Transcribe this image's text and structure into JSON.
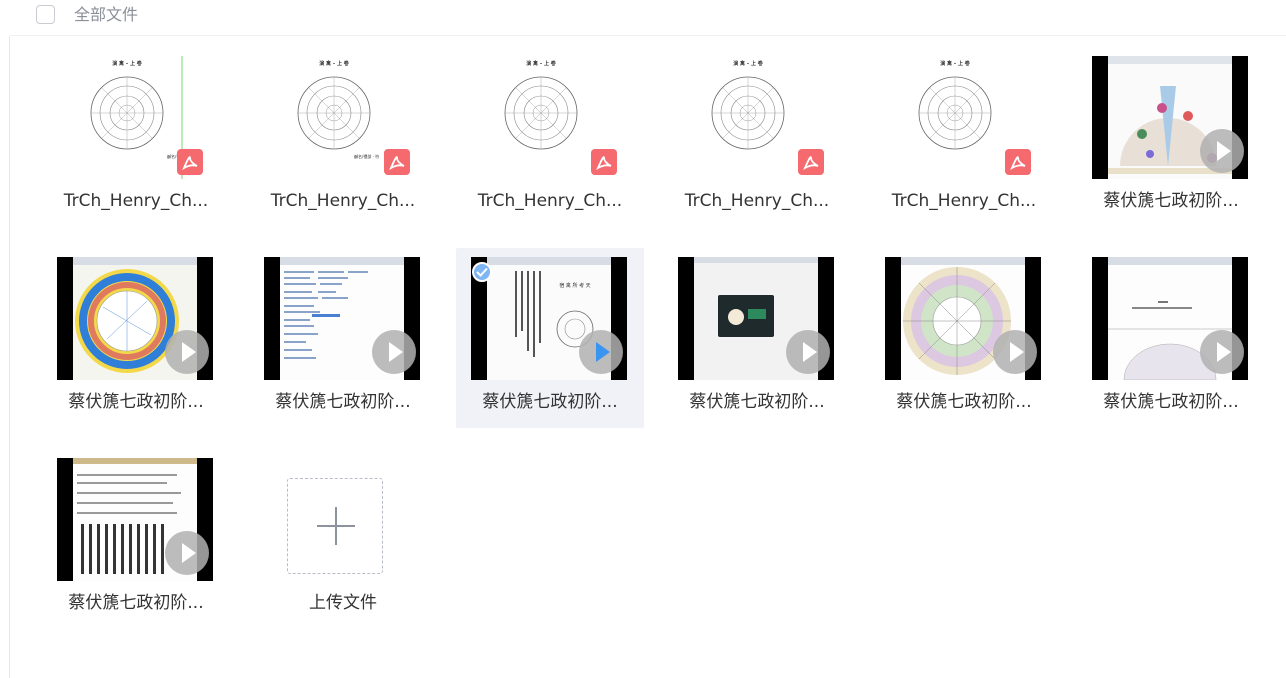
{
  "header": {
    "title": "全部文件"
  },
  "files": [
    {
      "name": "TrCh_Henry_Ch...",
      "kind": "pdf",
      "selected": false
    },
    {
      "name": "TrCh_Henry_Ch...",
      "kind": "pdf",
      "selected": false
    },
    {
      "name": "TrCh_Henry_Ch...",
      "kind": "pdf",
      "selected": false
    },
    {
      "name": "TrCh_Henry_Ch...",
      "kind": "pdf",
      "selected": false
    },
    {
      "name": "TrCh_Henry_Ch...",
      "kind": "pdf",
      "selected": false
    },
    {
      "name": "蔡伏篪七政初阶...",
      "kind": "video",
      "selected": false
    },
    {
      "name": "蔡伏篪七政初阶...",
      "kind": "video",
      "selected": false
    },
    {
      "name": "蔡伏篪七政初阶...",
      "kind": "video",
      "selected": false
    },
    {
      "name": "蔡伏篪七政初阶...",
      "kind": "video",
      "selected": true
    },
    {
      "name": "蔡伏篪七政初阶...",
      "kind": "video",
      "selected": false
    },
    {
      "name": "蔡伏篪七政初阶...",
      "kind": "video",
      "selected": false
    },
    {
      "name": "蔡伏篪七政初阶...",
      "kind": "video",
      "selected": false
    },
    {
      "name": "蔡伏篪七政初阶...",
      "kind": "video",
      "selected": false
    }
  ],
  "upload": {
    "label": "上传文件"
  },
  "colors": {
    "pdf_badge": "#f46a6f",
    "play_active": "#3a95f0",
    "play_idle": "#b0b0b0",
    "selected_bg": "#f0f2f8",
    "check": "#7eb6f5"
  }
}
